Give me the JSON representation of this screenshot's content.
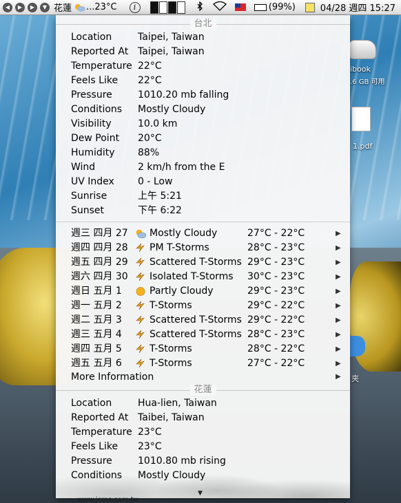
{
  "menubar": {
    "location": "花蓮",
    "temperature": "...23°C",
    "info_glyph": "i",
    "battery": "(99%)",
    "date": "04/28 週四 15:27"
  },
  "desktop": {
    "disk_label": "ibook",
    "disk_sub": ".6 GB 可用",
    "pdf_label": "1.pdf",
    "chat_label": "夾"
  },
  "taipei": {
    "header": "台北",
    "details": [
      {
        "label": "Location",
        "value": "Taipei, Taiwan"
      },
      {
        "label": "Reported At",
        "value": "Taipei, Taiwan"
      },
      {
        "label": "Temperature",
        "value": "22°C"
      },
      {
        "label": "Feels Like",
        "value": "22°C"
      },
      {
        "label": "Pressure",
        "value": "1010.20 mb falling"
      },
      {
        "label": "Conditions",
        "value": "Mostly Cloudy"
      },
      {
        "label": "Visibility",
        "value": "10.0 km"
      },
      {
        "label": "Dew Point",
        "value": "20°C"
      },
      {
        "label": "Humidity",
        "value": "88%"
      },
      {
        "label": "Wind",
        "value": "2 km/h from the E"
      },
      {
        "label": "UV Index",
        "value": "0 - Low"
      },
      {
        "label": "Sunrise",
        "value": "上午 5:21"
      },
      {
        "label": "Sunset",
        "value": "下午 6:22"
      }
    ],
    "forecast": [
      {
        "day": "週三 四月 27",
        "icon": "mostly-cloudy-icon",
        "cond": "Mostly Cloudy",
        "temp": "27°C - 22°C"
      },
      {
        "day": "週四 四月 28",
        "icon": "thunderstorm-icon",
        "cond": "PM T-Storms",
        "temp": "28°C - 23°C"
      },
      {
        "day": "週五 四月 29",
        "icon": "thunderstorm-icon",
        "cond": "Scattered T-Storms",
        "temp": "29°C - 23°C"
      },
      {
        "day": "週六 四月 30",
        "icon": "thunderstorm-icon",
        "cond": "Isolated T-Storms",
        "temp": "30°C - 23°C"
      },
      {
        "day": "週日 五月 1",
        "icon": "partly-cloudy-icon",
        "cond": "Partly Cloudy",
        "temp": "29°C - 23°C"
      },
      {
        "day": "週一 五月 2",
        "icon": "thunderstorm-icon",
        "cond": "T-Storms",
        "temp": "29°C - 22°C"
      },
      {
        "day": "週二 五月 3",
        "icon": "thunderstorm-icon",
        "cond": "Scattered T-Storms",
        "temp": "29°C - 22°C"
      },
      {
        "day": "週三 五月 4",
        "icon": "thunderstorm-icon",
        "cond": "Scattered T-Storms",
        "temp": "28°C - 23°C"
      },
      {
        "day": "週四 五月 5",
        "icon": "thunderstorm-icon",
        "cond": "T-Storms",
        "temp": "28°C - 22°C"
      },
      {
        "day": "週五 五月 6",
        "icon": "thunderstorm-icon",
        "cond": "T-Storms",
        "temp": "27°C - 22°C"
      }
    ],
    "more_info": "More Information"
  },
  "hualien": {
    "header": "花蓮",
    "details": [
      {
        "label": "Location",
        "value": "Hua-lien, Taiwan"
      },
      {
        "label": "Reported At",
        "value": "Taibei, Taiwan"
      },
      {
        "label": "Temperature",
        "value": "23°C"
      },
      {
        "label": "Feels Like",
        "value": "23°C"
      },
      {
        "label": "Pressure",
        "value": "1010.80 mb rising"
      },
      {
        "label": "Conditions",
        "value": "Mostly Cloudy"
      }
    ]
  },
  "footer": "www.jcms.com.tw",
  "colors": {
    "header_text": "#8a8a8a",
    "storm_icon": "#e8a020",
    "sun_icon": "#f5b21f",
    "cloud_icon": "#9fbfe0"
  }
}
